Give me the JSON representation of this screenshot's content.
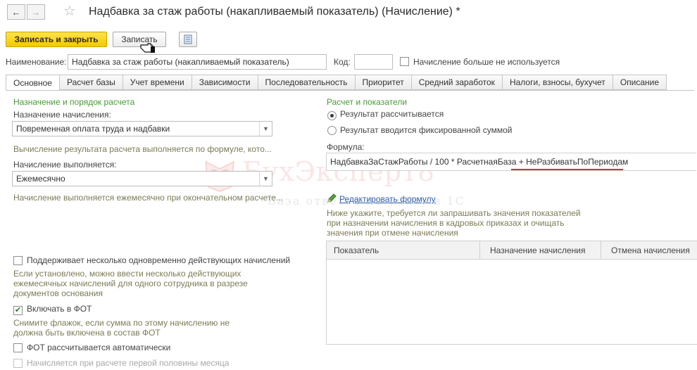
{
  "window": {
    "title": "Надбавка за стаж работы (накапливаемый показатель) (Начисление) *"
  },
  "toolbar": {
    "save_close_label": "Записать и закрыть",
    "save_label": "Записать"
  },
  "header": {
    "name_label": "Наименование:",
    "name_value": "Надбавка за стаж работы (накапливаемый показатель)",
    "code_label": "Код:",
    "code_value": "",
    "not_used_label": "Начисление больше не используется"
  },
  "tabs": [
    {
      "label": "Основное",
      "active": true
    },
    {
      "label": "Расчет базы"
    },
    {
      "label": "Учет времени"
    },
    {
      "label": "Зависимости"
    },
    {
      "label": "Последовательность"
    },
    {
      "label": "Приоритет"
    },
    {
      "label": "Средний заработок"
    },
    {
      "label": "Налоги, взносы, бухучет"
    },
    {
      "label": "Описание"
    }
  ],
  "left": {
    "section_title": "Назначение и порядок расчета",
    "purpose_label": "Назначение начисления:",
    "purpose_value": "Повременная оплата труда и надбавки",
    "purpose_hint": "Вычисление результата расчета выполняется по формуле, кото...",
    "period_label": "Начисление выполняется:",
    "period_value": "Ежемесячно",
    "period_hint": "Начисление выполняется ежемесячно при окончательном расчете...",
    "multi_label": "Поддерживает несколько одновременно действующих начислений",
    "multi_hint_1": "Если установлено, можно ввести несколько действующих",
    "multi_hint_2": "ежемесячных начислений для одного сотрудника в разрезе",
    "multi_hint_3": "документов основания",
    "fot_label": "Включать в ФОТ",
    "fot_hint_1": "Снимите флажок, если сумма по этому начислению не",
    "fot_hint_2": "должна быть включена в состав ФОТ",
    "fot_auto_label": "ФОТ рассчитывается автоматически",
    "half_month_label": "Начисляется при расчете первой половины месяца"
  },
  "right": {
    "section_title": "Расчет и показатели",
    "radio_calc_label": "Результат рассчитывается",
    "radio_fixed_label": "Результат вводится фиксированной суммой",
    "formula_label": "Формула:",
    "formula_value": "НадбавкаЗаСтажРаботы / 100 * РасчетнаяБаза + НеРазбиватьПоПериодам",
    "edit_formula_label": "Редактировать формулу",
    "indicators_hint_1": "Ниже укажите, требуется ли запрашивать значения показателей",
    "indicators_hint_2": "при назначении начисления в кадровых приказах и очищать",
    "indicators_hint_3": "значения при отмене начисления",
    "grid_headers": [
      "Показатель",
      "Назначение начисления",
      "Отмена начисления"
    ]
  },
  "watermark": {
    "title": "БухЭксперт8",
    "subtitle": "База ответов по учёту в 1С"
  },
  "colors": {
    "accent_yellow": "#f5c800",
    "section_green": "#4a9a3a",
    "hint_olive": "#7b7b56",
    "underline_red": "#d9312b"
  }
}
